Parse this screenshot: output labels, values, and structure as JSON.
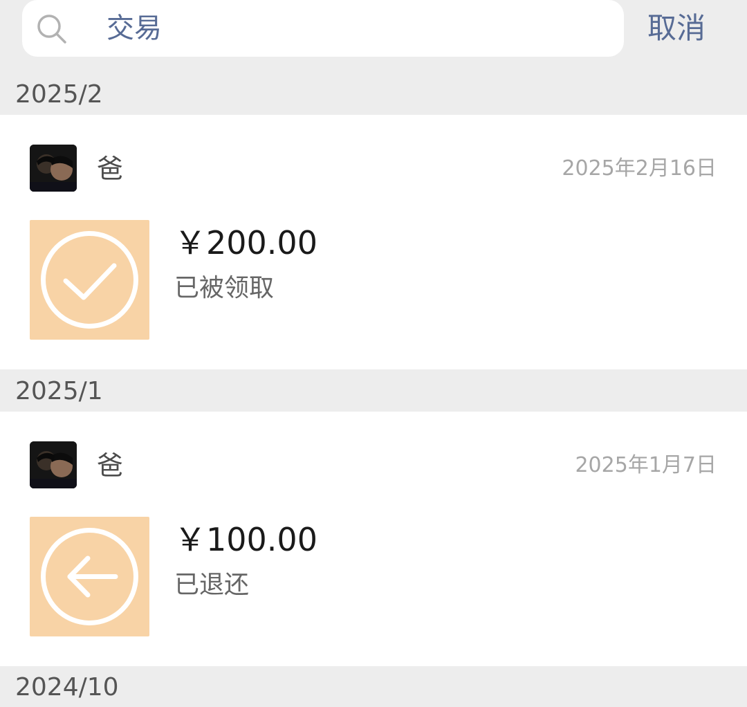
{
  "search": {
    "query": "交易",
    "icon": "search-icon",
    "cancel_label": "取消"
  },
  "months": [
    {
      "label": "2025/2",
      "transactions": [
        {
          "sender": "爸",
          "date": "2025年2月16日",
          "amount": "￥200.00",
          "status": "已被领取",
          "icon": "check-circle-icon"
        }
      ]
    },
    {
      "label": "2025/1",
      "transactions": [
        {
          "sender": "爸",
          "date": "2025年1月7日",
          "amount": "￥100.00",
          "status": "已退还",
          "icon": "arrow-left-circle-icon"
        }
      ]
    },
    {
      "label": "2024/10",
      "transactions": []
    }
  ],
  "colors": {
    "link": "#576b95",
    "icon_background": "#f8d3a6",
    "page_background": "#ededed"
  }
}
